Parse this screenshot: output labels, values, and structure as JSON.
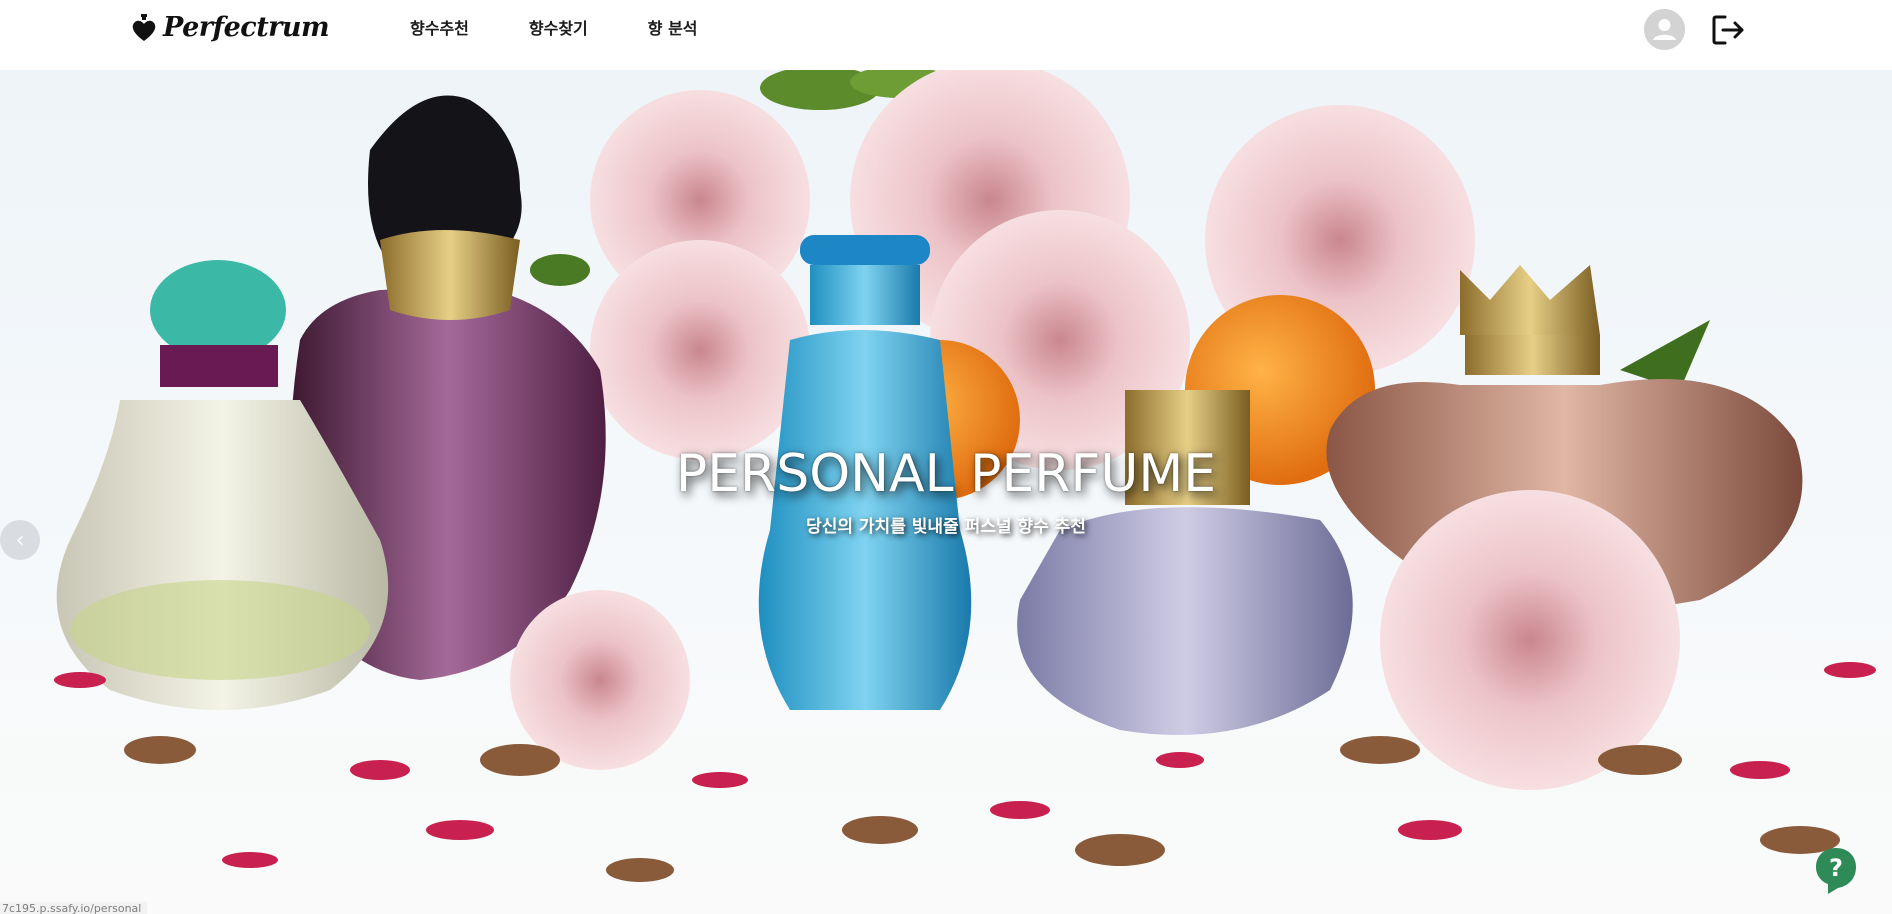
{
  "brand": {
    "name": "Perfectrum",
    "logo_icon": "perfume-heart-logo-icon"
  },
  "nav": {
    "items": [
      {
        "label": "향수추천"
      },
      {
        "label": "향수찾기"
      },
      {
        "label": "향 분석"
      }
    ]
  },
  "header": {
    "user_icon": "user-avatar-icon",
    "logout_icon": "logout-icon"
  },
  "hero": {
    "title": "PERSONAL PERFUME",
    "subtitle": "당신의 가치를 빛내줄 퍼스널 향수 추천",
    "prev_icon": "chevron-left-icon",
    "help_icon": "help-question-icon",
    "help_symbol": "?",
    "prev_symbol": "‹"
  },
  "status": {
    "url": "7c195.p.ssafy.io/personal"
  },
  "colors": {
    "header_bg": "#ffffff",
    "text_dark": "#1b1b1b",
    "avatar_gray": "#d3d3d3",
    "help_green": "#2e8b57"
  }
}
